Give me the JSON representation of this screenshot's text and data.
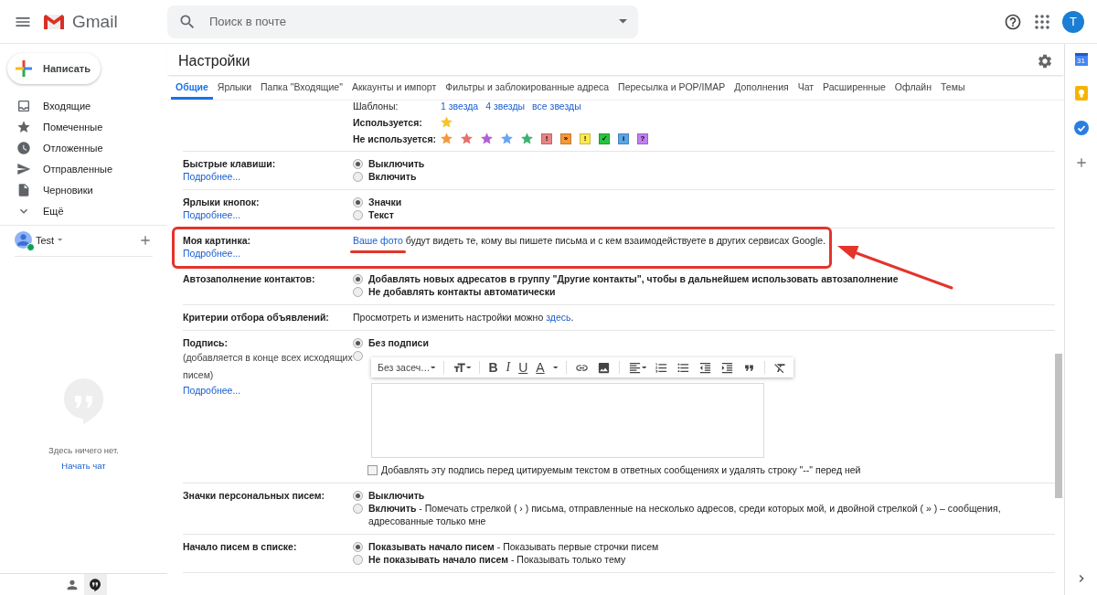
{
  "header": {
    "logo_text": "Gmail",
    "search": {
      "placeholder": "Поиск в почте"
    },
    "avatar_letter": "T"
  },
  "sidebar": {
    "compose": "Написать",
    "items": [
      {
        "kind": "inbox",
        "label": "Входящие"
      },
      {
        "kind": "starred",
        "label": "Помеченные"
      },
      {
        "kind": "snoozed",
        "label": "Отложенные"
      },
      {
        "kind": "sent",
        "label": "Отправленные"
      },
      {
        "kind": "drafts",
        "label": "Черновики"
      },
      {
        "kind": "more",
        "label": "Ещё"
      }
    ],
    "account": {
      "name": "Test",
      "online": true
    },
    "chat_empty": {
      "message": "Здесь ничего нет.",
      "link": "Начать чат"
    },
    "bottom_tabs": [
      {
        "kind": "contacts",
        "selected": false
      },
      {
        "kind": "hangouts",
        "selected": true
      }
    ]
  },
  "settings": {
    "title": "Настройки",
    "tabs": [
      {
        "label": "Общие",
        "selected": true
      },
      {
        "label": "Ярлыки",
        "selected": false
      },
      {
        "label": "Папка \"Входящие\"",
        "selected": false
      },
      {
        "label": "Аккаунты и импорт",
        "selected": false
      },
      {
        "label": "Фильтры и заблокированные адреса",
        "selected": false
      },
      {
        "label": "Пересылка и POP/IMAP",
        "selected": false
      },
      {
        "label": "Дополнения",
        "selected": false
      },
      {
        "label": "Чат",
        "selected": false
      },
      {
        "label": "Расширенные",
        "selected": false
      },
      {
        "label": "Офлайн",
        "selected": false
      },
      {
        "label": "Темы",
        "selected": false
      }
    ],
    "stars": {
      "presets_label": "Шаблоны:",
      "presets": [
        "1 звезда",
        "4 звезды",
        "все звезды"
      ],
      "in_use_label": "Используется:",
      "in_use": [
        {
          "kind": "star",
          "color": "#f7c32e"
        }
      ],
      "not_in_use_label": "Не используется:",
      "not_in_use": [
        {
          "kind": "star",
          "color": "#f69838"
        },
        {
          "kind": "star",
          "color": "#e6716a"
        },
        {
          "kind": "star",
          "color": "#b45fd4"
        },
        {
          "kind": "star",
          "color": "#6aa4f5"
        },
        {
          "kind": "star",
          "color": "#3cb272"
        },
        {
          "kind": "tag",
          "color": "#e98383",
          "glyph": "!"
        },
        {
          "kind": "tag",
          "color": "#f69838",
          "glyph": "»"
        },
        {
          "kind": "tag",
          "color": "#fce94f",
          "glyph": "!"
        },
        {
          "kind": "tag",
          "color": "#27c43e",
          "glyph": "✓"
        },
        {
          "kind": "tag",
          "color": "#58a6e8",
          "glyph": "i"
        },
        {
          "kind": "tag",
          "color": "#c27ef5",
          "glyph": "?"
        }
      ]
    },
    "rows": [
      {
        "kind": "radio",
        "label": "Быстрые клавиши:",
        "more": "Подробнее...",
        "options": [
          {
            "label": "Выключить",
            "selected": true
          },
          {
            "label": "Включить",
            "selected": false
          }
        ]
      },
      {
        "kind": "radio",
        "label": "Ярлыки кнопок:",
        "more": "Подробнее...",
        "options": [
          {
            "label": "Значки",
            "selected": true
          },
          {
            "label": "Текст",
            "selected": false
          }
        ]
      },
      {
        "kind": "link_text",
        "label": "Моя картинка:",
        "more": "Подробнее...",
        "highlighted": true,
        "link": "Ваше фото",
        "text_after": "будут видеть те, кому вы пишете письма и с кем взаимодействуете в других сервисах Google."
      },
      {
        "kind": "radio",
        "label": "Автозаполнение контактов:",
        "options": [
          {
            "label": "Добавлять новых адресатов в группу \"Другие контакты\", чтобы в дальнейшем использовать автозаполнение",
            "selected": true
          },
          {
            "label": "Не добавлять контакты автоматически",
            "selected": false
          }
        ]
      },
      {
        "kind": "text_link",
        "label": "Критерии отбора объявлений:",
        "text_before": "Просмотреть и изменить настройки можно",
        "link": "здесь",
        "text_after": "."
      },
      {
        "kind": "signature",
        "label": "Подпись:",
        "note": "(добавляется в конце всех исходящих писем)",
        "more": "Подробнее...",
        "options": [
          {
            "label": "Без подписи",
            "selected": true
          },
          {
            "selected": false
          }
        ],
        "editor": {
          "font": "Без засеч…",
          "letters": [
            "B",
            "I",
            "U",
            "A"
          ]
        },
        "checkbox": {
          "label": "Добавлять эту подпись перед цитируемым текстом в ответных сообщениях и удалять строку \"--\" перед ней",
          "checked": false
        }
      },
      {
        "kind": "radio",
        "label": "Значки персональных писем:",
        "options": [
          {
            "label": "Выключить",
            "selected": true
          },
          {
            "label": "Включить",
            "description": "- Помечать стрелкой ( › ) письма, отправленные на несколько адресов, среди которых мой, и двойной стрелкой ( » ) – сообщения, адресованные только мне",
            "selected": false
          }
        ]
      },
      {
        "kind": "radio",
        "label": "Начало писем в списке:",
        "options": [
          {
            "label": "Показывать начало писем",
            "description": "- Показывать первые строчки писем",
            "selected": true
          },
          {
            "label": "Не показывать начало писем",
            "description": "- Показывать только тему",
            "selected": false
          }
        ]
      }
    ]
  },
  "right_panel": {
    "calendar_day": "31"
  }
}
